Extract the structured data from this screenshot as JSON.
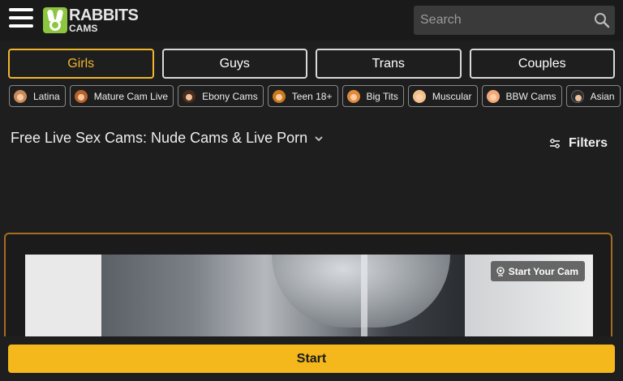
{
  "header": {
    "logo_line1": "RABBITS",
    "logo_line2": "CAMS",
    "search_placeholder": "Search"
  },
  "gender_tabs": [
    {
      "label": "Girls",
      "active": true
    },
    {
      "label": "Guys",
      "active": false
    },
    {
      "label": "Trans",
      "active": false
    },
    {
      "label": "Couples",
      "active": false
    }
  ],
  "categories": [
    {
      "label": "Latina",
      "icon": "latina-icon",
      "color": "#c78b5a"
    },
    {
      "label": "Mature Cam Live",
      "icon": "mature-icon",
      "color": "#b5622d"
    },
    {
      "label": "Ebony Cams",
      "icon": "ebony-icon",
      "color": "#4a2c1c"
    },
    {
      "label": "Teen 18+",
      "icon": "teen-icon",
      "color": "#c77a1e"
    },
    {
      "label": "Big Tits",
      "icon": "big-tits-icon",
      "color": "#e08a3c"
    },
    {
      "label": "Muscular",
      "icon": "muscle-icon",
      "color": "#f2c28c"
    },
    {
      "label": "BBW Cams",
      "icon": "bbw-icon",
      "color": "#f0a97a"
    },
    {
      "label": "Asian",
      "icon": "asian-icon",
      "color": "#2b2b2b"
    }
  ],
  "main": {
    "page_title": "Free Live Sex Cams: Nude Cams & Live Porn",
    "filters_label": "Filters"
  },
  "promo": {
    "start_cam_label": "Start Your Cam"
  },
  "footer": {
    "start_label": "Start"
  },
  "colors": {
    "accent": "#f0b62c",
    "start_button": "#f4b71c",
    "promo_border": "#a86b21",
    "logo_green": "#8cc63f"
  }
}
